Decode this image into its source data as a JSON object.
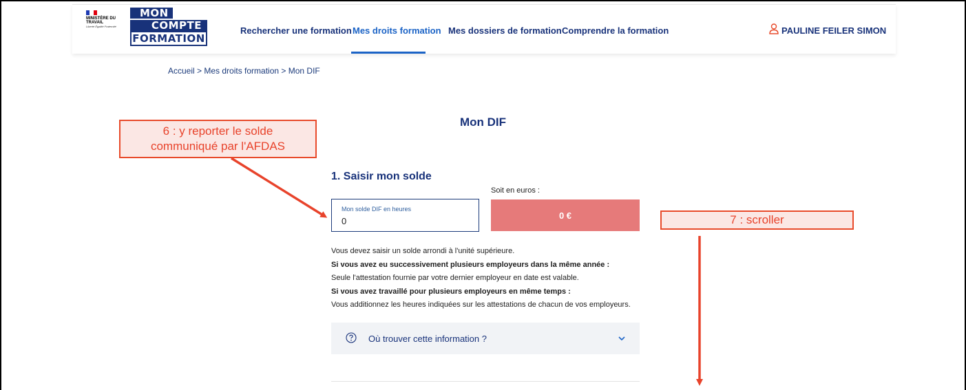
{
  "header": {
    "ministry": "MINISTÈRE DU TRAVAIL",
    "motto": "Liberté Égalité Fraternité",
    "logo": {
      "line1": "MON",
      "line2": "COMPTE",
      "line3": "FORMATION"
    },
    "nav": [
      {
        "label": "Rechercher une formation",
        "active": false
      },
      {
        "label": "Mes droits formation",
        "active": true
      },
      {
        "label": "Mes dossiers de formation",
        "active": false
      },
      {
        "label": "Comprendre la formation",
        "active": false
      }
    ],
    "user_name": "PAULINE FEILER SIMON",
    "user_icon": "user-icon"
  },
  "breadcrumb": "Accueil  >  Mes droits formation  >  Mon DIF",
  "page_title": "Mon DIF",
  "form": {
    "section_title": "1. Saisir mon solde",
    "euros_label": "Soit en euros :",
    "input_label": "Mon solde DIF en heures",
    "input_value": "0",
    "euro_value": "0 €"
  },
  "info": {
    "line1": "Vous devez saisir un solde arrondi à l'unité supérieure.",
    "line2": "Si vous avez eu successivement plusieurs employeurs dans la même année :",
    "line3": "Seule l'attestation fournie par votre dernier employeur en date est valable.",
    "line4": "Si vous avez travaillé pour plusieurs employeurs en même temps :",
    "line5": "Vous additionnez les heures indiquées sur les attestations de chacun de vos employeurs."
  },
  "accordion": {
    "label": "Où trouver cette information ?",
    "icon": "question-circle-icon",
    "chevron": "chevron-down-icon"
  },
  "annotations": {
    "callout6": {
      "line1": "6 : y reporter le solde",
      "line2": "communiqué par l'AFDAS"
    },
    "callout7": "7 : scroller"
  },
  "colors": {
    "brand_navy": "#18327a",
    "active_blue": "#1b63c6",
    "euro_box": "#e67a7a",
    "annotation_red": "#e8432b"
  }
}
